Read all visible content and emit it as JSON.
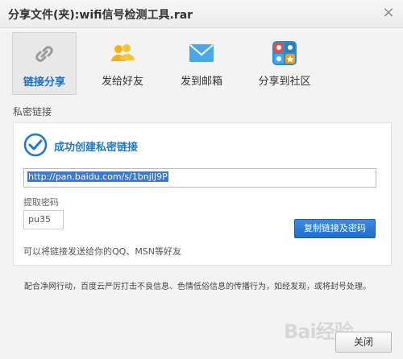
{
  "window": {
    "title": "分享文件(夹):wifi信号检测工具.rar",
    "close_glyph": "×"
  },
  "tabs": [
    {
      "label": "链接分享",
      "icon": "link-icon",
      "active": true
    },
    {
      "label": "发给好友",
      "icon": "friends-icon",
      "active": false
    },
    {
      "label": "发到邮箱",
      "icon": "mail-icon",
      "active": false
    },
    {
      "label": "分享到社区",
      "icon": "community-icon",
      "active": false
    }
  ],
  "section_label": "私密链接",
  "panel": {
    "success_text": "成功创建私密链接",
    "link_value": "http://pan.baidu.com/s/1bnjlJ9P",
    "code_label": "提取密码",
    "code_value": "pu35",
    "copy_button": "复制链接及密码",
    "hint": "可以将链接发送给你的QQ、MSN等好友"
  },
  "notice": "配合净网行动，百度云严厉打击不良信息、色情低俗信息的传播行为，如经发现，或将封号处理。",
  "footer": {
    "close_button": "关闭",
    "watermark": "Bai经验"
  },
  "colors": {
    "accent": "#1f78c8",
    "button_blue": "#2a7fd6",
    "selection": "#3a79d5"
  }
}
